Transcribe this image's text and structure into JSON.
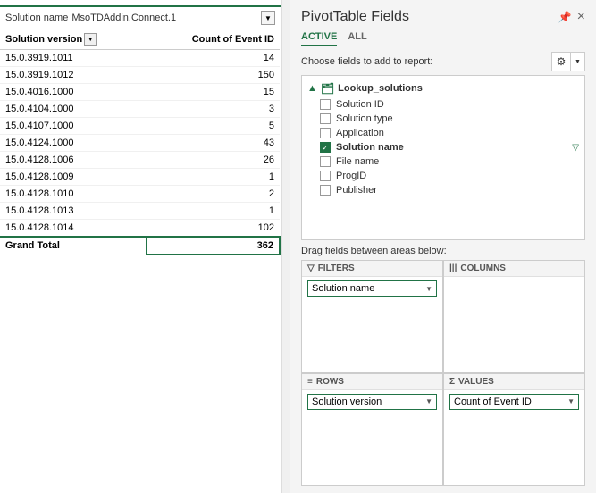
{
  "left": {
    "filter_label": "Solution name",
    "filter_value": "MsoTDAddin.Connect.1",
    "table": {
      "col1_header": "Solution version",
      "col2_header": "Count of Event ID",
      "rows": [
        {
          "version": "15.0.3919.1011",
          "count": "14"
        },
        {
          "version": "15.0.3919.1012",
          "count": "150"
        },
        {
          "version": "15.0.4016.1000",
          "count": "15"
        },
        {
          "version": "15.0.4104.1000",
          "count": "3"
        },
        {
          "version": "15.0.4107.1000",
          "count": "5"
        },
        {
          "version": "15.0.4124.1000",
          "count": "43"
        },
        {
          "version": "15.0.4128.1006",
          "count": "26"
        },
        {
          "version": "15.0.4128.1009",
          "count": "1"
        },
        {
          "version": "15.0.4128.1010",
          "count": "2"
        },
        {
          "version": "15.0.4128.1013",
          "count": "1"
        },
        {
          "version": "15.0.4128.1014",
          "count": "102"
        }
      ],
      "grand_total_label": "Grand Total",
      "grand_total_count": "362"
    }
  },
  "right": {
    "title": "PivotTable Fields",
    "close_icon": "×",
    "pin_icon": "📌",
    "tabs": [
      {
        "label": "ACTIVE",
        "active": true
      },
      {
        "label": "ALL",
        "active": false
      }
    ],
    "subtitle": "Choose fields to add to report:",
    "gear_icon": "⚙",
    "fields_group": {
      "name": "Lookup_solutions",
      "items": [
        {
          "label": "Solution ID",
          "checked": false
        },
        {
          "label": "Solution type",
          "checked": false
        },
        {
          "label": "Application",
          "checked": false
        },
        {
          "label": "Solution name",
          "checked": true,
          "has_filter": true
        },
        {
          "label": "File name",
          "checked": false
        },
        {
          "label": "ProgID",
          "checked": false
        },
        {
          "label": "Publisher",
          "checked": false
        }
      ]
    },
    "drag_label": "Drag fields between areas below:",
    "areas": {
      "filters": {
        "header": "FILTERS",
        "field": "Solution name"
      },
      "columns": {
        "header": "COLUMNS",
        "field": ""
      },
      "rows": {
        "header": "ROWS",
        "field": "Solution version"
      },
      "values": {
        "header": "VALUES",
        "field": "Count of Event ID"
      }
    }
  }
}
